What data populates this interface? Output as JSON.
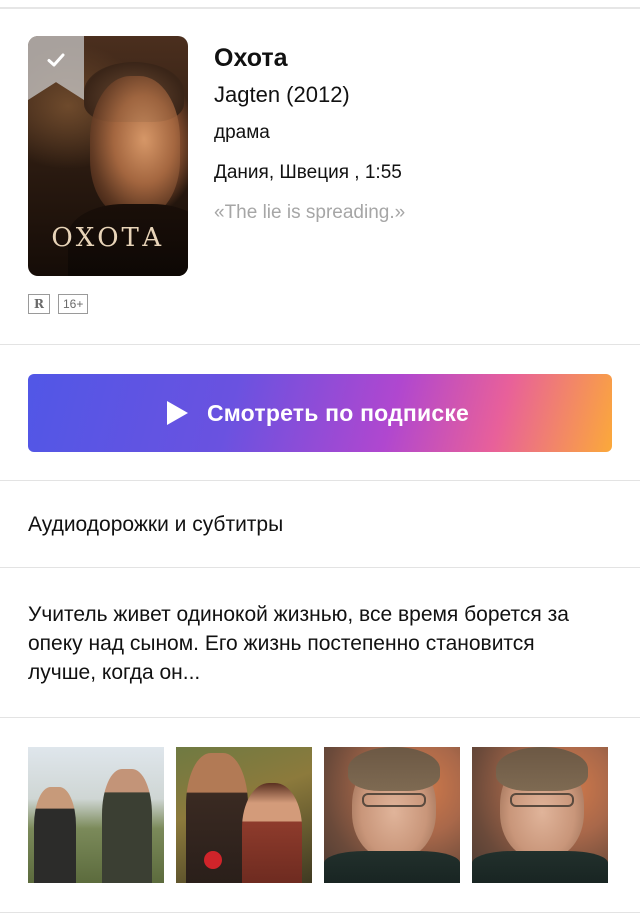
{
  "movie": {
    "title": "Охота",
    "original_title_year": "Jagten (2012)",
    "genre": "драма",
    "country_duration": "Дания, Швеция , 1:55",
    "tagline": "«The lie is spreading.»",
    "poster_title": "ОХОТА",
    "mpaa_rating": "R",
    "age_rating": "16+"
  },
  "watch_button": {
    "label": "Смотреть по подписке"
  },
  "audio_subtitles": {
    "label": "Аудиодорожки и субтитры"
  },
  "description": {
    "text": "Учитель живет одинокой жизнью, все время борется за опеку над сыном.  Его жизнь постепенно становится лучше, когда он..."
  },
  "stills": {
    "count_visible": 4
  },
  "colors": {
    "button_gradient_start": "#5157e6",
    "button_gradient_mid": "#b047cf",
    "button_gradient_end": "#fba93a",
    "tagline": "#a6a6a6",
    "divider": "#e3e3e3"
  },
  "icons": {
    "watched_marker": "check-icon",
    "play": "play-icon"
  }
}
